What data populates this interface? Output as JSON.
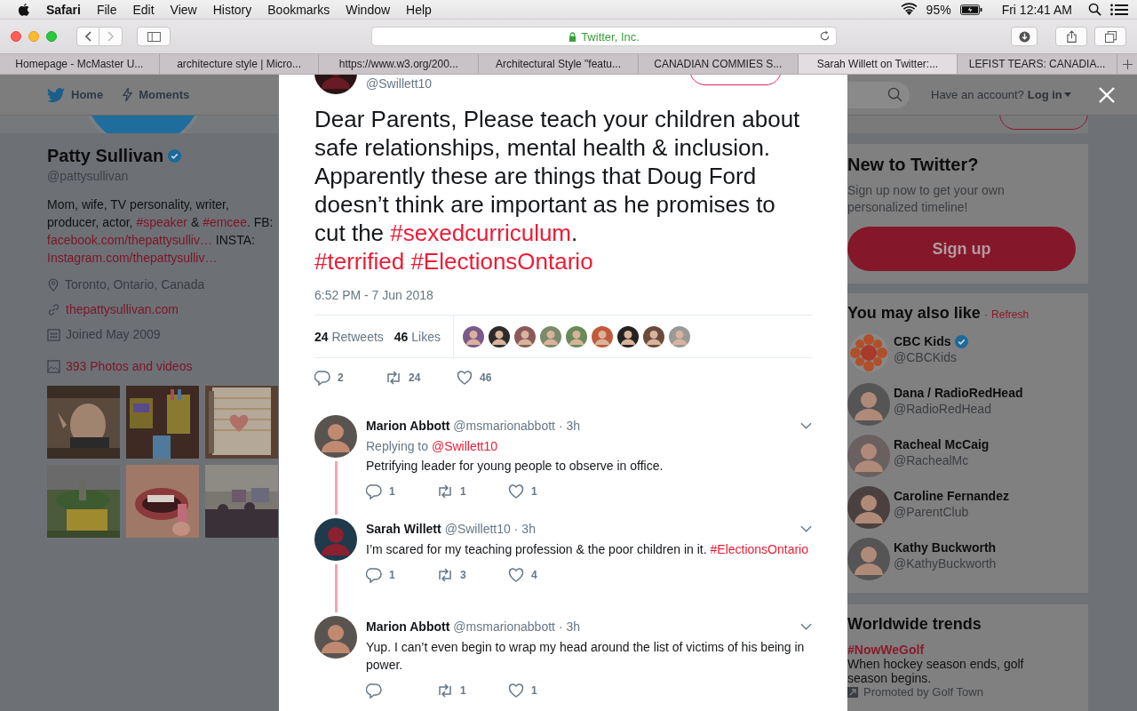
{
  "menubar": {
    "app": "Safari",
    "menus": [
      "File",
      "Edit",
      "View",
      "History",
      "Bookmarks",
      "Window",
      "Help"
    ],
    "battery": "95%",
    "clock": "Fri 12:41 AM"
  },
  "browser": {
    "address": "Twitter, Inc.",
    "tabs": [
      {
        "label": "Homepage - McMaster U...",
        "selected": false
      },
      {
        "label": "architecture style | Micro...",
        "selected": false
      },
      {
        "label": "https://www.w3.org/200...",
        "selected": false
      },
      {
        "label": "Architectural Style \"featu...",
        "selected": false
      },
      {
        "label": "CANADIAN COMMIES S...",
        "selected": false
      },
      {
        "label": "Sarah Willett on Twitter:...",
        "selected": true
      },
      {
        "label": "LEFIST TEARS: CANADIA...",
        "selected": false
      }
    ]
  },
  "nav": {
    "items": [
      {
        "label": "Home",
        "kind": "bird"
      },
      {
        "label": "Moments",
        "kind": "bolt"
      }
    ],
    "account_prompt": "Have an account?",
    "login": "Log in"
  },
  "profile": {
    "name": "Patty Sullivan",
    "verified": true,
    "handle": "@pattysullivan",
    "bio": [
      {
        "text": "Mom, wife, TV personality, writer, producer, actor, ",
        "kind": "text"
      },
      {
        "text": "#speaker",
        "kind": "link"
      },
      {
        "text": " & ",
        "kind": "text"
      },
      {
        "text": "#emcee",
        "kind": "link"
      },
      {
        "text": ". FB: ",
        "kind": "text"
      },
      {
        "text": "facebook.com/thepattysulliv…",
        "kind": "link"
      },
      {
        "text": " INSTA: ",
        "kind": "text"
      },
      {
        "text": "Instagram.com/thepattysulliv…",
        "kind": "link"
      }
    ],
    "location": "Toronto, Ontario, Canada",
    "website": "thepattysullivan.com",
    "joined": "Joined May 2009",
    "media_label": "393 Photos and videos"
  },
  "tweet": {
    "handle": "@Swillett10",
    "text": [
      {
        "text": "Dear Parents, Please teach your children about safe relationships, mental health & inclusion. Apparently these are things that Doug Ford doesn’t think are important as he promises to cut the ",
        "kind": "text"
      },
      {
        "text": "#sexedcurriculum",
        "kind": "link"
      },
      {
        "text": ". ",
        "kind": "text"
      },
      {
        "text": "#terrified ",
        "kind": "link"
      },
      {
        "text": "#ElectionsOntario",
        "kind": "link"
      }
    ],
    "timestamp": "6:52 PM - 7 Jun 2018",
    "retweets": {
      "count": "24",
      "label": "Retweets"
    },
    "likes": {
      "count": "46",
      "label": "Likes"
    },
    "likers": [
      {
        "kind": "avatar"
      },
      {
        "kind": "avatar"
      },
      {
        "kind": "avatar"
      },
      {
        "kind": "avatar"
      },
      {
        "kind": "avatar"
      },
      {
        "kind": "avatar"
      },
      {
        "kind": "avatar"
      },
      {
        "kind": "avatar"
      },
      {
        "kind": "avatar"
      }
    ],
    "actions": [
      {
        "kind": "reply",
        "count": "2"
      },
      {
        "kind": "retweet",
        "count": "24"
      },
      {
        "kind": "like",
        "count": "46"
      }
    ]
  },
  "replies": [
    {
      "name": "Marion Abbott",
      "handle": "@msmarionabbott",
      "time": "· 3h",
      "replying_label": "Replying to",
      "replying_to": "@Swillett10",
      "text": [
        {
          "text": "Petrifying leader for young people to observe in office.",
          "kind": "text"
        }
      ],
      "actions": [
        {
          "kind": "reply",
          "count": "1"
        },
        {
          "kind": "retweet",
          "count": "1"
        },
        {
          "kind": "like",
          "count": "1"
        }
      ]
    },
    {
      "name": "Sarah Willett",
      "handle": "@Swillett10",
      "time": "· 3h",
      "text": [
        {
          "text": "I’m scared for my teaching profession & the poor children in it. ",
          "kind": "text"
        },
        {
          "text": "#ElectionsOntario",
          "kind": "link"
        }
      ],
      "actions": [
        {
          "kind": "reply",
          "count": "1"
        },
        {
          "kind": "retweet",
          "count": "3"
        },
        {
          "kind": "like",
          "count": "4"
        }
      ]
    },
    {
      "name": "Marion Abbott",
      "handle": "@msmarionabbott",
      "time": "· 3h",
      "text": [
        {
          "text": "Yup. I can’t even begin to wrap my head around the list of victims of his being in power.",
          "kind": "text"
        }
      ],
      "actions": [
        {
          "kind": "reply"
        },
        {
          "kind": "retweet",
          "count": "1"
        },
        {
          "kind": "like",
          "count": "1"
        }
      ]
    }
  ],
  "sidebar": {
    "signup": {
      "title": "New to Twitter?",
      "text": "Sign up now to get your own personalized timeline!",
      "button": "Sign up"
    },
    "suggestions": {
      "title": "You may also like",
      "separator": "·",
      "refresh": "Refresh",
      "accounts": [
        {
          "name": "CBC Kids",
          "handle": "@CBCKids",
          "verified": true
        },
        {
          "name": "Dana / RadioRedHead",
          "handle": "@RadioRedHead",
          "verified": false
        },
        {
          "name": "Racheal McCaig",
          "handle": "@RachealMc",
          "verified": false
        },
        {
          "name": "Caroline Fernandez",
          "handle": "@ParentClub",
          "verified": false
        },
        {
          "name": "Kathy Buckworth",
          "handle": "@KathyBuckworth",
          "verified": false
        }
      ]
    },
    "trends": {
      "title": "Worldwide trends",
      "items": [
        {
          "tag": "#NowWeGolf",
          "description": "When hockey season ends, golf season begins.",
          "promoted": "Promoted by Golf Town"
        }
      ]
    }
  }
}
